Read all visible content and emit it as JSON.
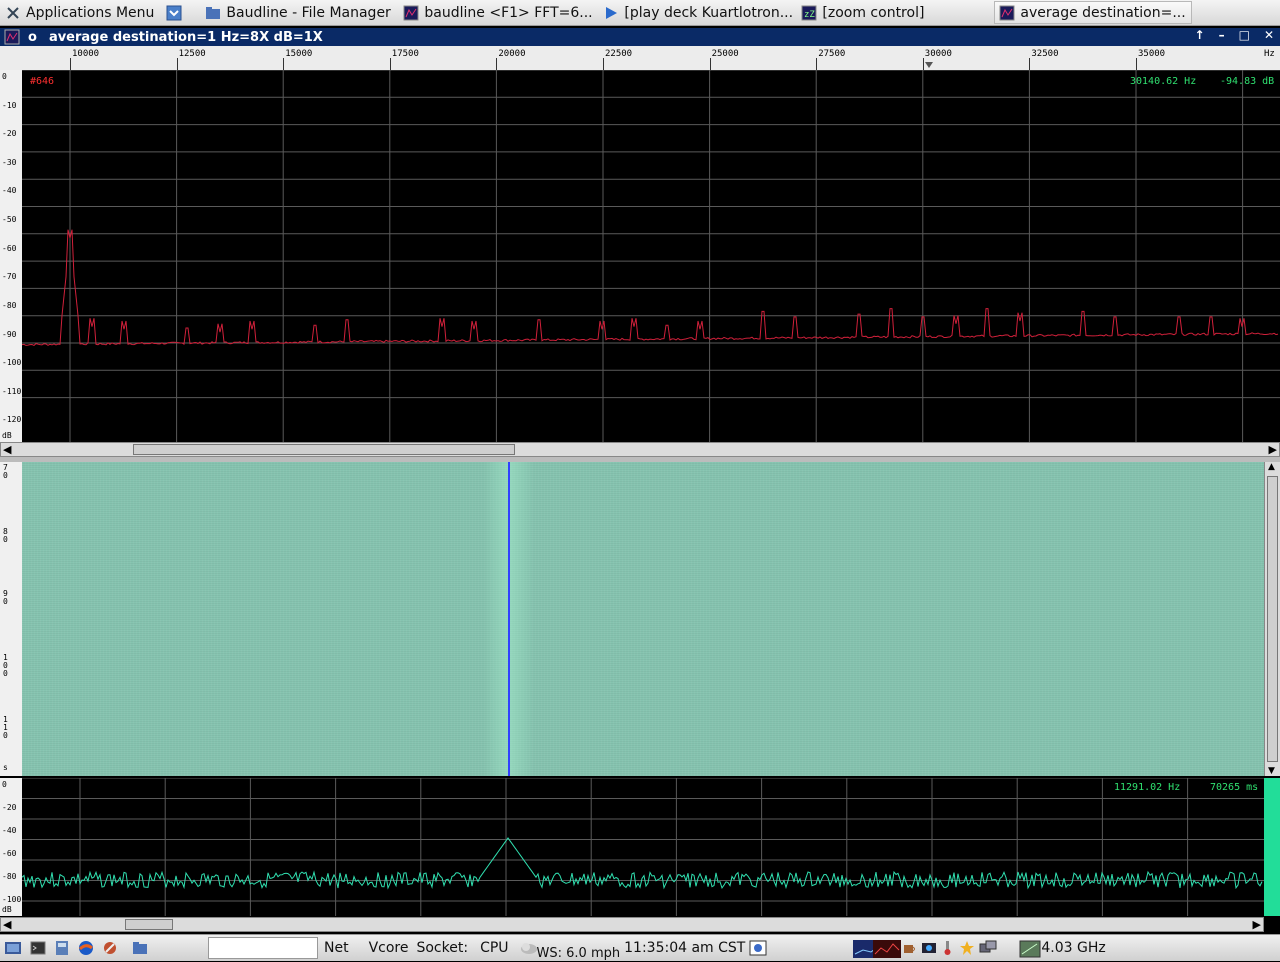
{
  "taskbar": {
    "apps_menu": "Applications Menu",
    "windows": [
      {
        "label": "Baudline - File Manager"
      },
      {
        "label": "baudline  <F1> FFT=6..."
      },
      {
        "label": "[play deck  Kuartlotron..."
      },
      {
        "label": "[zoom control]"
      },
      {
        "label": "average   destination=..."
      }
    ]
  },
  "window": {
    "title": "average    destination=1 Hz=8X dB=1X",
    "title_prefix": "o"
  },
  "ruler": {
    "ticks": [
      "10000",
      "12500",
      "15000",
      "17500",
      "20000",
      "22500",
      "25000",
      "27500",
      "30000",
      "32500",
      "35000"
    ],
    "unit": "Hz"
  },
  "spectrum": {
    "db_labels": [
      "0",
      "-10",
      "-20",
      "-30",
      "-40",
      "-50",
      "-60",
      "-70",
      "-80",
      "-90",
      "-100",
      "-110",
      "-120",
      "dB"
    ],
    "marker_label": "#646",
    "cursor_freq": "30140.62 Hz",
    "cursor_db": "-94.83 dB",
    "colors": {
      "trace": "#d0203a",
      "grid": "#5a5a5a",
      "marker": "#ff3030",
      "readout": "#30e070"
    }
  },
  "waterfall": {
    "time_labels": [
      {
        "text": [
          "7",
          "0"
        ]
      },
      {
        "text": [
          "8",
          "0"
        ]
      },
      {
        "text": [
          "9",
          "0"
        ]
      },
      {
        "text": [
          "1",
          "0",
          "0"
        ]
      },
      {
        "text": [
          "1",
          "1",
          "0"
        ]
      },
      {
        "text": [
          "s"
        ]
      }
    ],
    "colors": {
      "bg": "#86c4b0",
      "line": "#3040ff"
    }
  },
  "timepanel": {
    "db_labels": [
      "0",
      "-20",
      "-40",
      "-60",
      "-80",
      "-100",
      "dB"
    ],
    "freq_readout": "11291.02 Hz",
    "time_readout": "70265 ms",
    "colors": {
      "trace": "#30e0b0",
      "readout": "#30e070"
    }
  },
  "bottombar": {
    "net": "Net",
    "vcore": "Vcore",
    "socket": "Socket:",
    "cpu": "CPU",
    "weather": "WS: 6.0 mph",
    "clock": "11:35:04 am CST",
    "cpu_freq": "4.03 GHz"
  }
}
